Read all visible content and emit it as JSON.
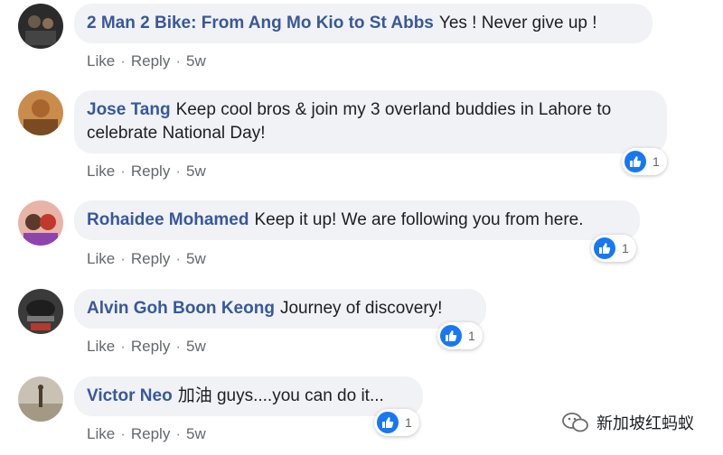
{
  "comments": [
    {
      "author": "2 Man 2 Bike: From Ang Mo Kio to St Abbs",
      "text": "Yes ! Never give up !",
      "like": "Like",
      "reply": "Reply",
      "time": "5w",
      "reaction_icon": "thumbs-up-icon",
      "reactions": ""
    },
    {
      "author": "Jose Tang",
      "text": "Keep cool bros & join my 3 overland buddies in Lahore to celebrate National Day!",
      "like": "Like",
      "reply": "Reply",
      "time": "5w",
      "reaction_icon": "thumbs-up-icon",
      "reactions": "1"
    },
    {
      "author": "Rohaidee Mohamed",
      "text": "Keep it up! We are following you from here.",
      "like": "Like",
      "reply": "Reply",
      "time": "5w",
      "reaction_icon": "thumbs-up-icon",
      "reactions": "1"
    },
    {
      "author": "Alvin Goh Boon Keong",
      "text": "Journey of discovery!",
      "like": "Like",
      "reply": "Reply",
      "time": "5w",
      "reaction_icon": "thumbs-up-icon",
      "reactions": "1"
    },
    {
      "author": "Victor Neo",
      "text": "加油 guys....you can do it...",
      "like": "Like",
      "reply": "Reply",
      "time": "5w",
      "reaction_icon": "thumbs-up-icon",
      "reactions": "1"
    }
  ],
  "separator": "·",
  "watermark": {
    "icon": "wechat-icon",
    "text": "新加坡红蚂蚁"
  },
  "colors": {
    "author": "#385898",
    "bubble": "#f0f2f5",
    "like_blue": "#1877f2",
    "meta": "#65676b"
  }
}
